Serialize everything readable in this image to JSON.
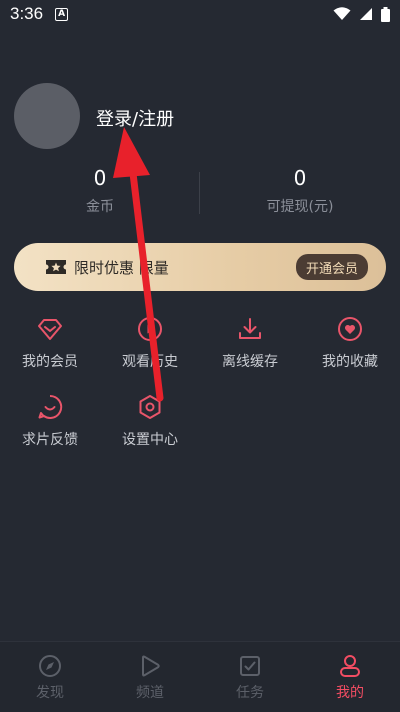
{
  "status_bar": {
    "time": "3:36",
    "notification_letter": "A",
    "icons": [
      "wifi-icon",
      "signal-icon",
      "battery-icon"
    ]
  },
  "profile": {
    "login_label": "登录/注册"
  },
  "stats": [
    {
      "value": "0",
      "label": "金币"
    },
    {
      "value": "0",
      "label": "可提现(元)"
    }
  ],
  "vip_banner": {
    "text": "限时优惠 限量",
    "button_label": "开通会员"
  },
  "grid": [
    {
      "icon": "diamond-icon",
      "label": "我的会员"
    },
    {
      "icon": "play-circle-icon",
      "label": "观看历史"
    },
    {
      "icon": "download-icon",
      "label": "离线缓存"
    },
    {
      "icon": "heart-icon",
      "label": "我的收藏"
    },
    {
      "icon": "feedback-icon",
      "label": "求片反馈"
    },
    {
      "icon": "settings-hexagon-icon",
      "label": "设置中心"
    }
  ],
  "bottom_nav": [
    {
      "icon": "compass-icon",
      "label": "发现",
      "active": false
    },
    {
      "icon": "play-icon",
      "label": "频道",
      "active": false
    },
    {
      "icon": "task-icon",
      "label": "任务",
      "active": false
    },
    {
      "icon": "user-icon",
      "label": "我的",
      "active": true
    }
  ],
  "colors": {
    "background": "#252932",
    "accent": "#f34d63",
    "icon_red": "#e9556a",
    "vip_gold": "#e6cca5",
    "annotation_arrow": "#e8212b"
  }
}
